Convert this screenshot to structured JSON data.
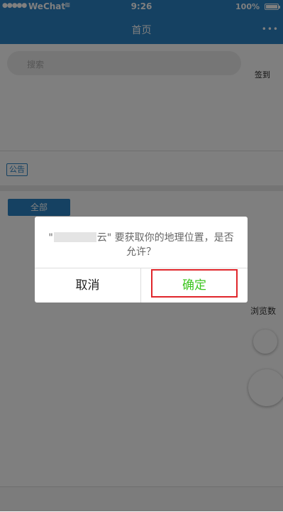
{
  "status_bar": {
    "signal": "●●●●●",
    "carrier": "WeChat",
    "wifi_icon": "wifi-icon",
    "time": "9:26",
    "battery_pct": "100%"
  },
  "nav": {
    "title": "首页",
    "more_icon": "•••"
  },
  "search": {
    "placeholder": "搜索",
    "signin_label": "签到"
  },
  "notice": {
    "badge": "公告"
  },
  "tabs": {
    "all_label": "全部"
  },
  "list": {
    "views_label": "浏览数"
  },
  "dialog": {
    "message_prefix": "\"",
    "message_suffix": "云\" 要获取你的地理位置，是否允许？",
    "cancel_label": "取消",
    "confirm_label": "确定"
  },
  "colors": {
    "accent": "#2b82c4",
    "confirm": "#3cc51f",
    "highlight": "#e0262b"
  }
}
